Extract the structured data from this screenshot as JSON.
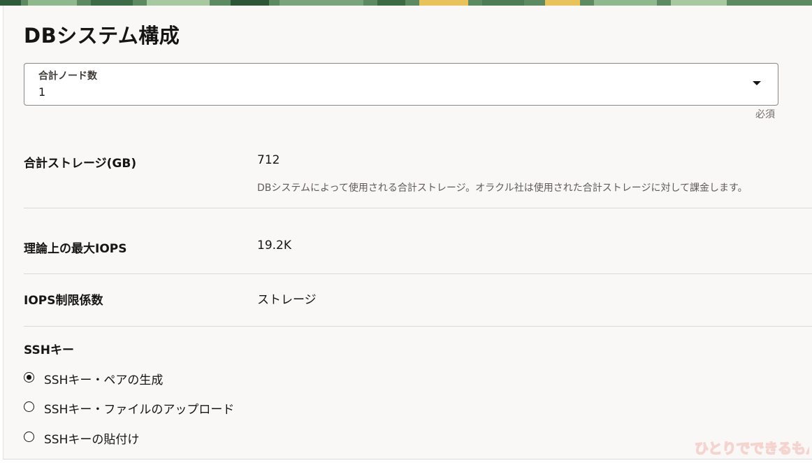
{
  "page_title": "DBシステム構成",
  "node_count": {
    "label": "合計ノード数",
    "value": "1",
    "required_text": "必須"
  },
  "storage": {
    "label": "合計ストレージ(GB)",
    "value": "712",
    "description": "DBシステムによって使用される合計ストレージ。オラクル社は使用された合計ストレージに対して課金します。"
  },
  "iops": {
    "label": "理論上の最大IOPS",
    "value": "19.2K"
  },
  "iops_factor": {
    "label": "IOPS制限係数",
    "value": "ストレージ"
  },
  "ssh": {
    "title": "SSHキー",
    "options": [
      {
        "label": "SSHキー・ペアの生成",
        "selected": true
      },
      {
        "label": "SSHキー・ファイルのアップロード",
        "selected": false
      },
      {
        "label": "SSHキーの貼付け",
        "selected": false
      }
    ]
  },
  "colors": {
    "panel_background": "#f9f8f6",
    "text": "#161513",
    "muted_text": "#6f6b67",
    "divider": "#dcd8d3",
    "banner_green": "#5e8a63",
    "banner_yellow": "#e9c25b"
  },
  "icons": {
    "dropdown": "caret-down-icon",
    "radio_selected": "radio-checked-icon",
    "radio_unselected": "radio-unchecked-icon"
  },
  "watermark_text": "ひとりでできるもん"
}
